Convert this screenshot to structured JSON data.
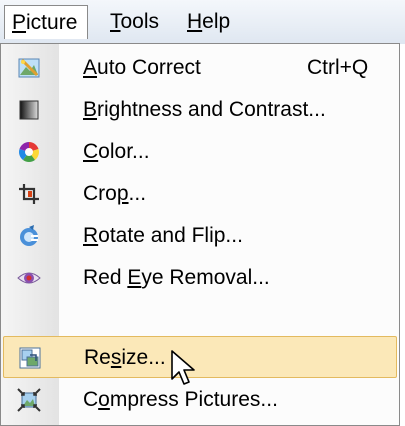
{
  "menubar": {
    "items": [
      {
        "label": "Picture",
        "mnemonic": "P",
        "rest": "icture",
        "active": true
      },
      {
        "label": "Tools",
        "mnemonic": "T",
        "rest": "ools",
        "active": false
      },
      {
        "label": "Help",
        "mnemonic": "H",
        "rest": "elp",
        "active": false
      }
    ]
  },
  "menu": {
    "items": [
      {
        "label": "Auto Correct",
        "pre": "",
        "mnemonic": "A",
        "post": "uto Correct",
        "shortcut": "Ctrl+Q",
        "icon": "auto-correct-icon"
      },
      {
        "label": "Brightness and Contrast...",
        "pre": "",
        "mnemonic": "B",
        "post": "rightness and Contrast...",
        "icon": "brightness-contrast-icon"
      },
      {
        "label": "Color...",
        "pre": "",
        "mnemonic": "C",
        "post": "olor...",
        "icon": "color-wheel-icon"
      },
      {
        "label": "Crop...",
        "pre": "Cro",
        "mnemonic": "p",
        "post": "...",
        "icon": "crop-icon"
      },
      {
        "label": "Rotate and Flip...",
        "pre": "",
        "mnemonic": "R",
        "post": "otate and Flip...",
        "icon": "rotate-flip-icon"
      },
      {
        "label": "Red Eye Removal...",
        "pre": "Red ",
        "mnemonic": "E",
        "post": "ye Removal...",
        "icon": "red-eye-icon"
      },
      {
        "label": "Resize...",
        "pre": "Re",
        "mnemonic": "s",
        "post": "ize...",
        "icon": "resize-icon",
        "highlighted": true
      },
      {
        "label": "Compress Pictures...",
        "pre": "C",
        "mnemonic": "o",
        "post": "mpress Pictures...",
        "icon": "compress-pictures-icon"
      }
    ]
  },
  "colors": {
    "highlight_fill": "#fbe8b8",
    "highlight_border": "#e3ba5f",
    "menubar_top": "#f4f7fb",
    "menubar_bottom": "#dfe7f1"
  }
}
